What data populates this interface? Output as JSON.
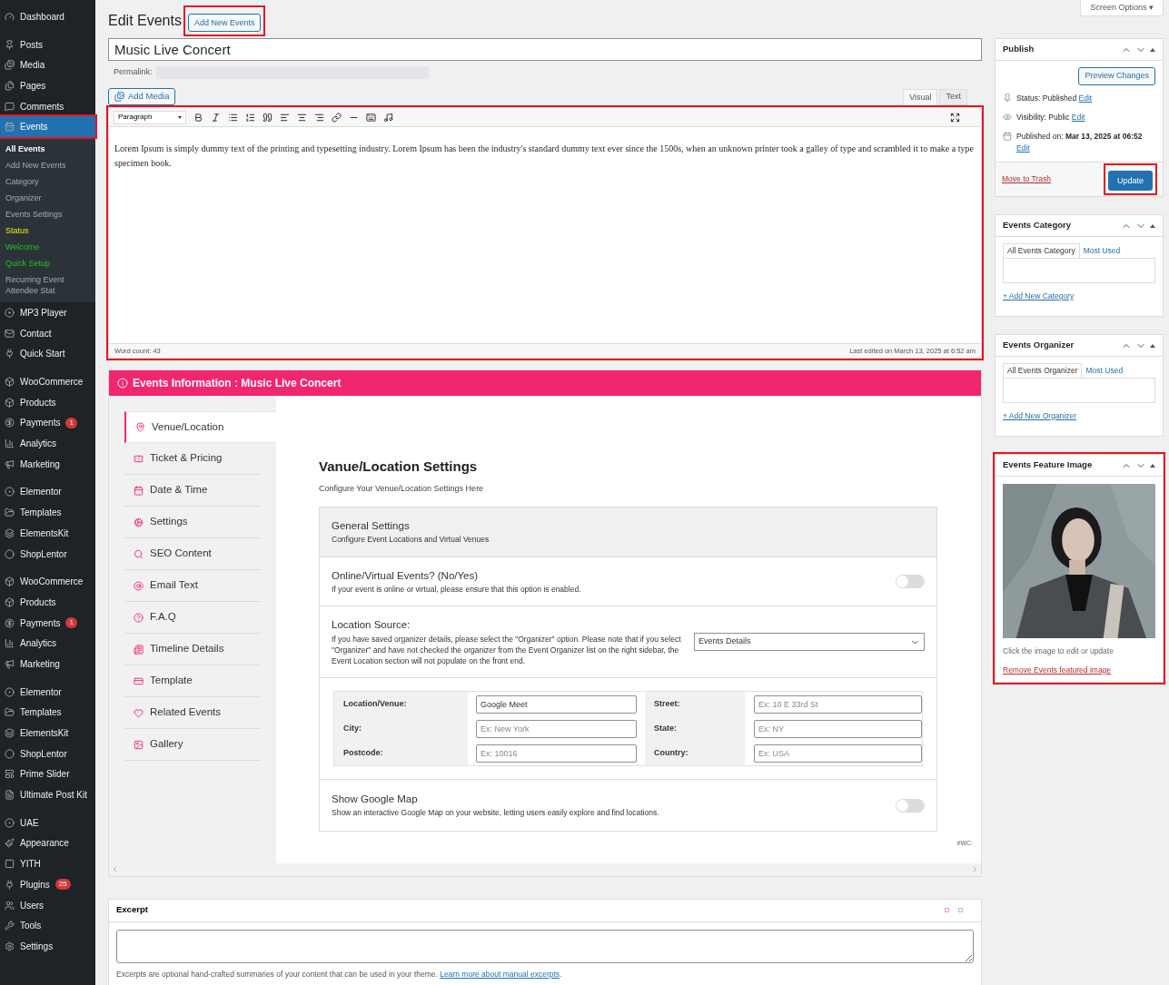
{
  "sidebar": {
    "groups": [
      [
        {
          "label": "Dashboard",
          "selected": false,
          "highlighted": false
        }
      ],
      [
        {
          "label": "Posts",
          "selected": false,
          "highlighted": false
        },
        {
          "label": "Media",
          "selected": false,
          "highlighted": false
        },
        {
          "label": "Pages",
          "selected": false,
          "highlighted": false
        },
        {
          "label": "Comments",
          "selected": false,
          "highlighted": false
        },
        {
          "label": "Events",
          "selected": true,
          "highlighted": true,
          "children": [
            {
              "label": "All Events",
              "kind": "current"
            },
            {
              "label": "Add New Events",
              "kind": "plain"
            },
            {
              "label": "Category",
              "kind": "plain"
            },
            {
              "label": "Organizer",
              "kind": "plain"
            },
            {
              "label": "Events Settings",
              "kind": "plain"
            },
            {
              "label": "Status",
              "kind": "warning"
            },
            {
              "label": "Welcome",
              "kind": "success"
            },
            {
              "label": "Quick Setup",
              "kind": "success"
            },
            {
              "label": "Recurring Event Attendee Stat",
              "kind": "plain"
            }
          ]
        },
        {
          "label": "MP3 Player",
          "selected": false,
          "highlighted": false
        },
        {
          "label": "Contact",
          "selected": false,
          "highlighted": false
        },
        {
          "label": "Quick Start",
          "selected": false,
          "highlighted": false
        }
      ],
      [
        {
          "label": "WooCommerce",
          "selected": false,
          "highlighted": false
        },
        {
          "label": "Products",
          "selected": false,
          "highlighted": false
        },
        {
          "label": "Payments",
          "badge": "1",
          "selected": false,
          "highlighted": false
        },
        {
          "label": "Analytics",
          "selected": false,
          "highlighted": false
        },
        {
          "label": "Marketing",
          "selected": false,
          "highlighted": false
        }
      ],
      [
        {
          "label": "Elementor",
          "selected": false,
          "highlighted": false
        },
        {
          "label": "Templates",
          "selected": false,
          "highlighted": false
        },
        {
          "label": "ElementsKit",
          "selected": false,
          "highlighted": false
        },
        {
          "label": "ShopLentor",
          "selected": false,
          "highlighted": false
        }
      ],
      [
        {
          "label": "WooCommerce",
          "selected": false,
          "highlighted": false
        },
        {
          "label": "Products",
          "selected": false,
          "highlighted": false
        },
        {
          "label": "Payments",
          "badge": "1",
          "selected": false,
          "highlighted": false
        },
        {
          "label": "Analytics",
          "selected": false,
          "highlighted": false
        },
        {
          "label": "Marketing",
          "selected": false,
          "highlighted": false
        }
      ],
      [
        {
          "label": "Elementor",
          "selected": false,
          "highlighted": false
        },
        {
          "label": "Templates",
          "selected": false,
          "highlighted": false
        },
        {
          "label": "ElementsKit",
          "selected": false,
          "highlighted": false
        },
        {
          "label": "ShopLentor",
          "selected": false,
          "highlighted": false
        },
        {
          "label": "Prime Slider",
          "selected": false,
          "highlighted": false
        },
        {
          "label": "Ultimate Post Kit",
          "selected": false,
          "highlighted": false
        }
      ],
      [
        {
          "label": "UAE",
          "selected": false,
          "highlighted": false
        },
        {
          "label": "Appearance",
          "selected": false,
          "highlighted": false
        },
        {
          "label": "YITH",
          "selected": false,
          "highlighted": false
        },
        {
          "label": "Plugins",
          "badge": "25",
          "selected": false,
          "highlighted": false
        },
        {
          "label": "Users",
          "selected": false,
          "highlighted": false
        },
        {
          "label": "Tools",
          "selected": false,
          "highlighted": false
        },
        {
          "label": "Settings",
          "selected": false,
          "highlighted": false
        }
      ]
    ]
  },
  "header": {
    "title": "Edit Events",
    "add_new": {
      "label": "Add New Events",
      "highlighted": true
    },
    "screen_options": "Screen Options ▾"
  },
  "post": {
    "title": "Music Live Concert",
    "permalink_label": "Permalink:"
  },
  "editor": {
    "highlighted": true,
    "add_media": "Add Media",
    "tabs": [
      {
        "label": "Visual",
        "selected": true
      },
      {
        "label": "Text",
        "selected": false
      }
    ],
    "format": "Paragraph",
    "content": "Lorem Ipsum is simply dummy text of the printing and typesetting industry. Lorem Ipsum has been the industry's standard dummy text ever since the 1500s, when an unknown printer took a galley of type and scrambled it to make a type specimen book.",
    "word_count": "Word count: 43",
    "last_edited": "Last edited on March 13, 2025 at 6:52 am"
  },
  "events_info": {
    "title": "Events Information : Music Live Concert",
    "tabs": [
      {
        "label": "Venue/Location",
        "selected": true
      },
      {
        "label": "Ticket & Pricing",
        "selected": false
      },
      {
        "label": "Date & Time",
        "selected": false
      },
      {
        "label": "Settings",
        "selected": false
      },
      {
        "label": "SEO Content",
        "selected": false
      },
      {
        "label": "Email Text",
        "selected": false
      },
      {
        "label": "F.A.Q",
        "selected": false
      },
      {
        "label": "Timeline Details",
        "selected": false
      },
      {
        "label": "Template",
        "selected": false
      },
      {
        "label": "Related Events",
        "selected": false
      },
      {
        "label": "Gallery",
        "selected": false
      }
    ],
    "heading": "Vanue/Location Settings",
    "subheading": "Configure Your Venue/Location Settings Here",
    "general": {
      "title": "General Settings",
      "description": "Configure Event Locations and Virtual Venues"
    },
    "online": {
      "title": "Online/Virtual Events? (No/Yes)",
      "description": "If your event is online or virtual, please ensure that this option is enabled.",
      "on": false
    },
    "location_source": {
      "title": "Location Source:",
      "description": "If you have saved organizer details, please select the \"Organizer\" option. Please note that if you select \"Organizer\" and have not checked the organizer from the Event Organizer list on the right sidebar, the Event Location section will not populate on the front end.",
      "value": "Events Details"
    },
    "fields": [
      {
        "label": "Location/Venue:",
        "value": "Google Meet"
      },
      {
        "label": "Street:",
        "placeholder": "Ex: 10 E 33rd St"
      },
      {
        "label": "City:",
        "placeholder": "Ex: New York"
      },
      {
        "label": "State:",
        "placeholder": "Ex: NY"
      },
      {
        "label": "Postcode:",
        "placeholder": "Ex: 10016"
      },
      {
        "label": "Country:",
        "placeholder": "Ex: USA"
      }
    ],
    "map": {
      "title": "Show Google Map",
      "description": "Show an interactive Google Map on your website, letting users easily explore and find locations.",
      "on": false
    },
    "footnote": "#WC:"
  },
  "excerpt": {
    "title": "Excerpt",
    "note": "Excerpts are optional hand-crafted summaries of your content that can be used in your theme. ",
    "link": "Learn more about manual excerpts",
    "period": "."
  },
  "publish": {
    "title": "Publish",
    "preview": "Preview Changes",
    "rows": [
      {
        "label": "Status:",
        "value": "Published",
        "link": "Edit"
      },
      {
        "label": "Visibility:",
        "value": "Public",
        "link": "Edit"
      },
      {
        "label": "Published on:",
        "value": "Mar 13, 2025 at 06:52",
        "link": "Edit"
      }
    ],
    "trash": "Move to Trash",
    "update": {
      "label": "Update",
      "highlighted": true
    }
  },
  "category": {
    "title": "Events Category",
    "tabs": [
      {
        "label": "All Events Category",
        "selected": true
      },
      {
        "label": "Most Used",
        "selected": false
      }
    ],
    "add": "+ Add New Category"
  },
  "organizer": {
    "title": "Events Organizer",
    "tabs": [
      {
        "label": "All Events Organizer",
        "selected": true
      },
      {
        "label": "Most Used",
        "selected": false
      }
    ],
    "add": "+ Add New Organizer"
  },
  "feature_image": {
    "title": "Events Feature Image",
    "highlighted": true,
    "hint": "Click the image to edit or update",
    "remove": "Remove Events featured image"
  }
}
